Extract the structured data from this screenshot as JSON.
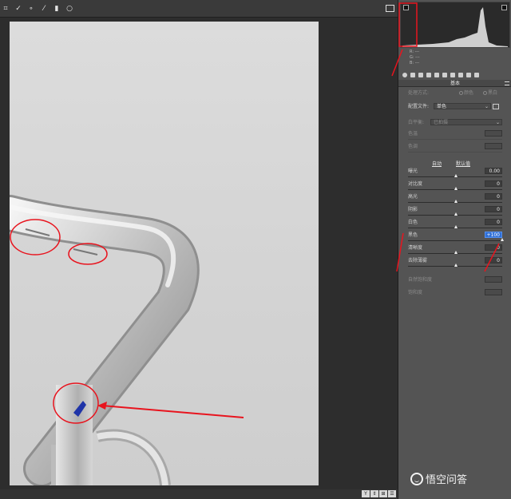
{
  "toolbar": {
    "icons": [
      "crop-icon",
      "spot-removal-icon",
      "red-eye-icon",
      "adjustment-brush-icon",
      "graduated-filter-icon",
      "radial-filter-icon"
    ],
    "right_icon": "open-in-window-icon"
  },
  "histogram": {
    "rgb_labels": [
      "R:",
      "G:",
      "B:"
    ],
    "rgb_values": [
      "---",
      "---",
      "---"
    ]
  },
  "panel": {
    "title": "基本",
    "treatment_label": "处理方式:",
    "treatment_color": "颜色",
    "treatment_bw": "黑白",
    "profile_label": "配置文件:",
    "profile_value": "单色",
    "wb_label": "白平衡:",
    "wb_value": "已拍摄",
    "temp_label": "色温",
    "tint_label": "色调",
    "auto_label": "自动",
    "default_label": "默认值",
    "sliders": [
      {
        "label": "曝光",
        "value": "0.00",
        "level": 0.5
      },
      {
        "label": "对比度",
        "value": "0",
        "level": 0.5
      },
      {
        "label": "高光",
        "value": "0",
        "level": 0.5
      },
      {
        "label": "阴影",
        "value": "0",
        "level": 0.5
      },
      {
        "label": "白色",
        "value": "0",
        "level": 0.5
      },
      {
        "label": "黑色",
        "value": "+100",
        "level": 1.0
      },
      {
        "label": "清晰度",
        "value": "0",
        "level": 0.5
      },
      {
        "label": "去除薄雾",
        "value": "0",
        "level": 0.5
      }
    ],
    "vibrance_label": "自然饱和度",
    "saturation_label": "饱和度"
  },
  "statusbar": {
    "buttons": [
      "Y",
      "⇕",
      "⊞",
      "☰"
    ]
  },
  "watermark": {
    "text": "悟空问答"
  },
  "colors": {
    "annotation": "#e8141e",
    "highlight": "#2f6fd6"
  }
}
